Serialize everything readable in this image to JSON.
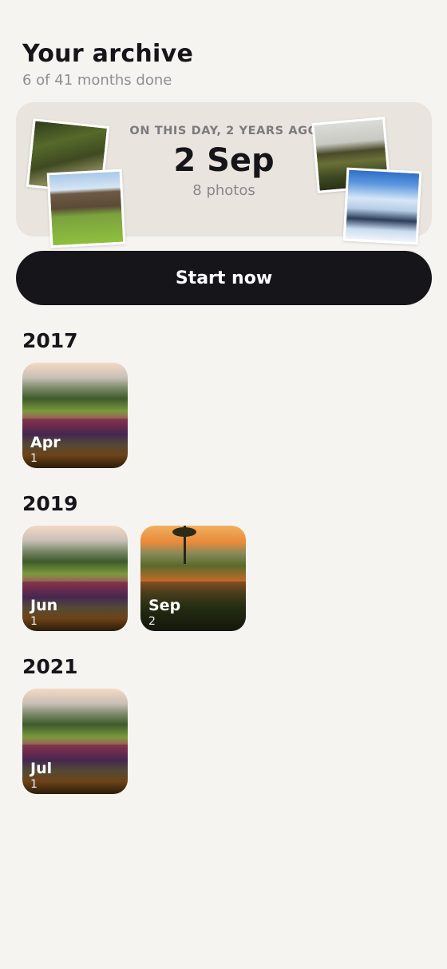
{
  "header": {
    "title": "Your archive",
    "subtitle": "6 of 41 months done"
  },
  "on_this_day": {
    "label": "ON THIS DAY, 2 YEARS AGO",
    "date": "2 Sep",
    "count": "8 photos"
  },
  "start_button": {
    "label": "Start now"
  },
  "years": [
    {
      "year": "2017",
      "months": [
        {
          "month": "Apr",
          "count": "1",
          "image": "garden"
        }
      ]
    },
    {
      "year": "2019",
      "months": [
        {
          "month": "Jun",
          "count": "1",
          "image": "garden"
        },
        {
          "month": "Sep",
          "count": "2",
          "image": "sunset"
        }
      ]
    },
    {
      "year": "2021",
      "months": [
        {
          "month": "Jul",
          "count": "1",
          "image": "garden"
        }
      ]
    }
  ]
}
